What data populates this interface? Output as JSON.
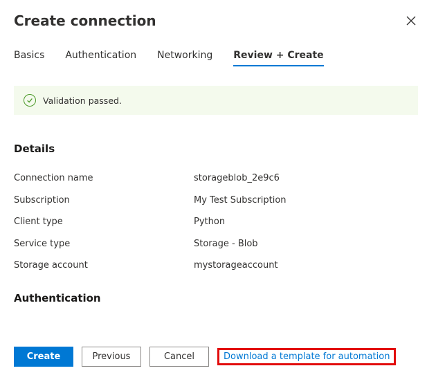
{
  "header": {
    "title": "Create connection"
  },
  "tabs": {
    "items": [
      {
        "label": "Basics",
        "active": false
      },
      {
        "label": "Authentication",
        "active": false
      },
      {
        "label": "Networking",
        "active": false
      },
      {
        "label": "Review + Create",
        "active": true
      }
    ]
  },
  "validation": {
    "message": "Validation passed."
  },
  "details": {
    "heading": "Details",
    "rows": [
      {
        "key": "Connection name",
        "value": "storageblob_2e9c6"
      },
      {
        "key": "Subscription",
        "value": "My Test Subscription"
      },
      {
        "key": "Client type",
        "value": "Python"
      },
      {
        "key": "Service type",
        "value": "Storage - Blob"
      },
      {
        "key": "Storage account",
        "value": "mystorageaccount"
      }
    ]
  },
  "authentication": {
    "heading": "Authentication"
  },
  "footer": {
    "create_label": "Create",
    "previous_label": "Previous",
    "cancel_label": "Cancel",
    "download_label": "Download a template for automation"
  }
}
